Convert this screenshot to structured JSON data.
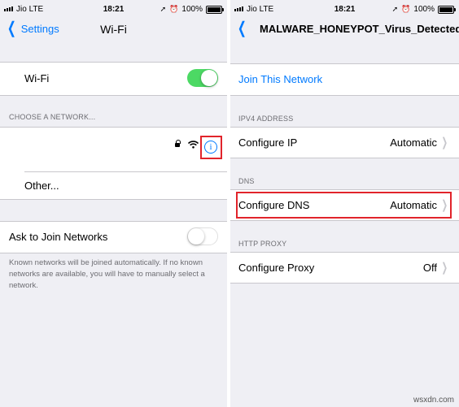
{
  "left": {
    "status": {
      "carrier": "Jio",
      "network": "LTE",
      "time": "18:21",
      "battery": "100%"
    },
    "nav": {
      "back": "Settings",
      "title": "Wi-Fi"
    },
    "wifi": {
      "label": "Wi-Fi",
      "enabled": true
    },
    "choose_network_header": "CHOOSE A NETWORK...",
    "network_other": "Other...",
    "ask_to_join": {
      "label": "Ask to Join Networks",
      "enabled": false
    },
    "footer": "Known networks will be joined automatically. If no known networks are available, you will have to manually select a network."
  },
  "right": {
    "status": {
      "carrier": "Jio",
      "network": "LTE",
      "time": "18:21",
      "battery": "100%"
    },
    "nav": {
      "title": "MALWARE_HONEYPOT_Virus_Detected"
    },
    "join": "Join This Network",
    "ipv4_header": "IPV4 ADDRESS",
    "configure_ip": {
      "label": "Configure IP",
      "value": "Automatic"
    },
    "dns_header": "DNS",
    "configure_dns": {
      "label": "Configure DNS",
      "value": "Automatic"
    },
    "proxy_header": "HTTP PROXY",
    "configure_proxy": {
      "label": "Configure Proxy",
      "value": "Off"
    }
  },
  "watermark": "wsxdn.com",
  "colors": {
    "accent": "#007aff",
    "toggle_on": "#4cd964",
    "highlight": "#e1242b",
    "background": "#efeff4"
  }
}
